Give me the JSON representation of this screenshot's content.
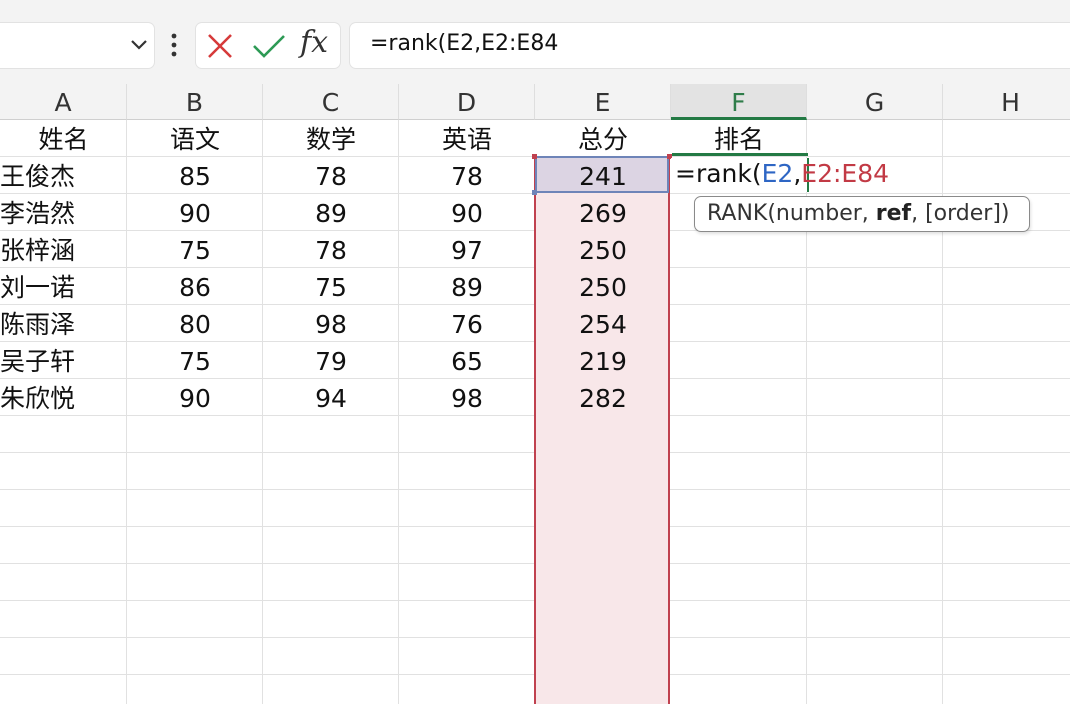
{
  "formula_bar": {
    "name_box": "",
    "cancel_icon": "x-icon",
    "enter_icon": "check-icon",
    "fx_label": "fx",
    "formula": "=rank(E2,E2:E84"
  },
  "columns": [
    "A",
    "B",
    "C",
    "D",
    "E",
    "F",
    "G",
    "H"
  ],
  "headers": [
    "姓名",
    "语文",
    "数学",
    "英语",
    "总分",
    "排名"
  ],
  "rows": [
    {
      "name": "王俊杰",
      "chinese": "85",
      "math": "78",
      "english": "78",
      "total": "241"
    },
    {
      "name": "李浩然",
      "chinese": "90",
      "math": "89",
      "english": "90",
      "total": "269"
    },
    {
      "name": "张梓涵",
      "chinese": "75",
      "math": "78",
      "english": "97",
      "total": "250"
    },
    {
      "name": "刘一诺",
      "chinese": "86",
      "math": "75",
      "english": "89",
      "total": "250"
    },
    {
      "name": "陈雨泽",
      "chinese": "80",
      "math": "98",
      "english": "76",
      "total": "254"
    },
    {
      "name": "吴子轩",
      "chinese": "75",
      "math": "79",
      "english": "65",
      "total": "219"
    },
    {
      "name": "朱欣悦",
      "chinese": "90",
      "math": "94",
      "english": "98",
      "total": "282"
    }
  ],
  "edit_cell": {
    "prefix": "=rank(",
    "ref1": "E2",
    "sep": ",",
    "ref2": "E2:E84"
  },
  "tooltip": {
    "prefix": "RANK(number, ",
    "bold": "ref",
    "suffix": ", [order])"
  },
  "colors": {
    "accent_green": "#237a44",
    "ref_blue": "#2e66c4",
    "ref_red": "#c23a45",
    "range_fill": "#f8e7e9"
  }
}
